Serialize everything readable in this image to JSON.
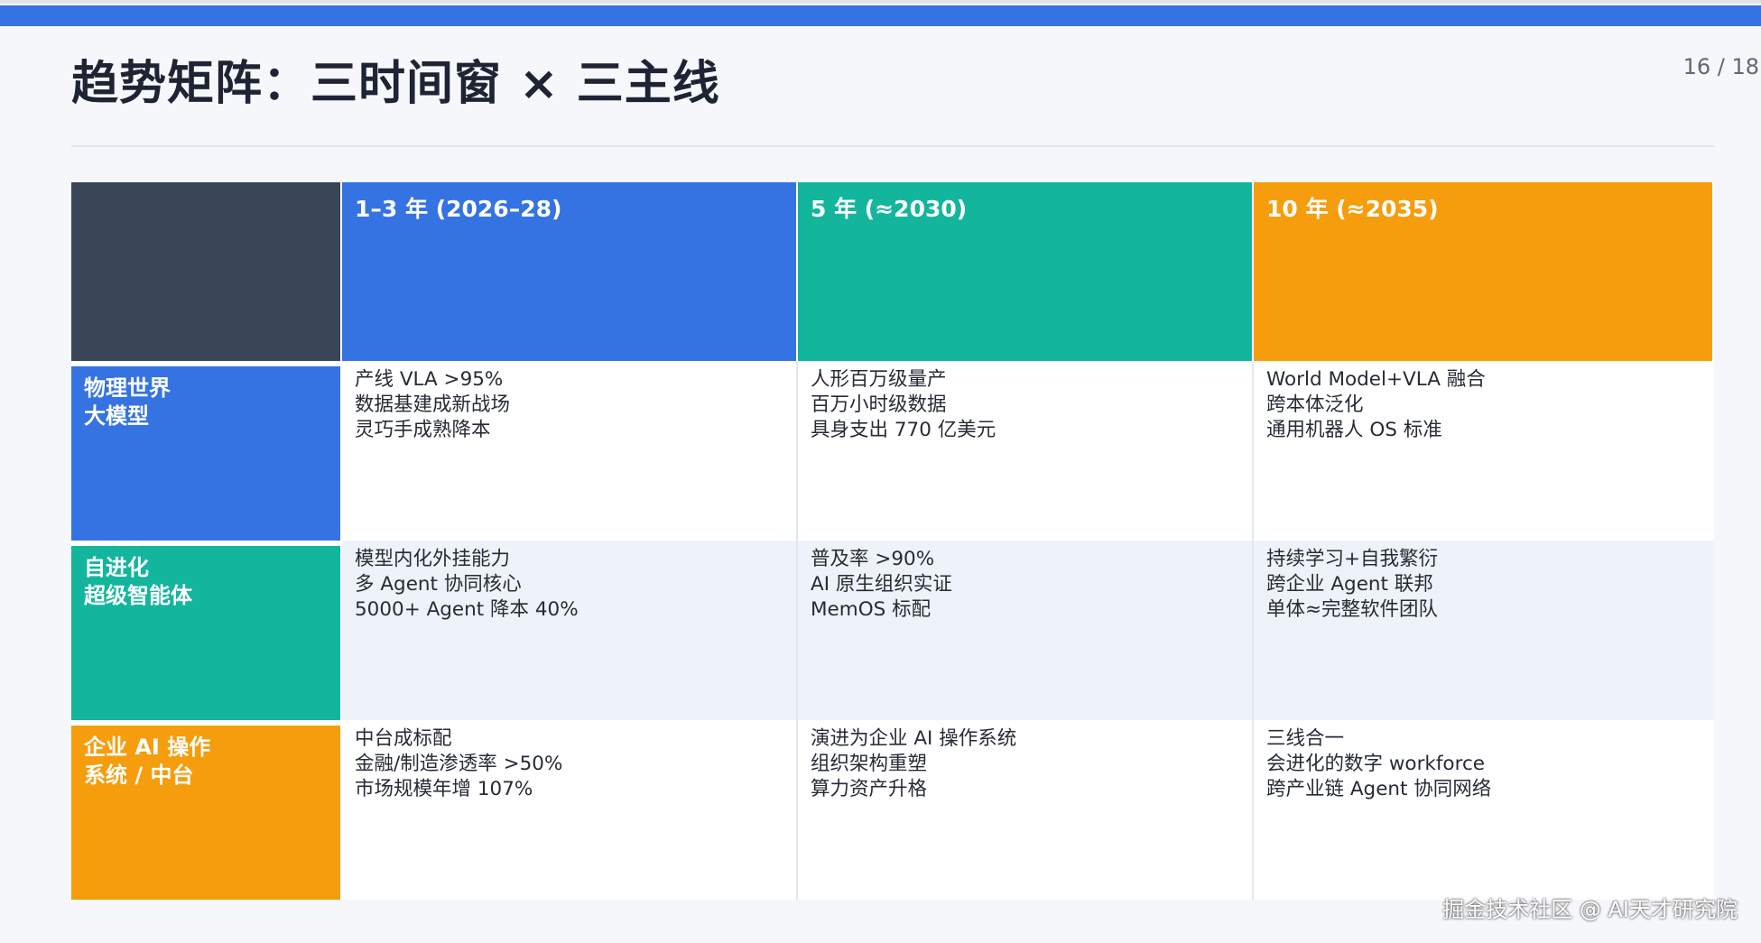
{
  "slide": {
    "title": "趋势矩阵：三时间窗 × 三主线",
    "page_number": "16 / 18"
  },
  "watermark": "掘金技术社区 @ AI天才研究院",
  "colors": {
    "accent_bar": "#3573e2",
    "corner": "#384657",
    "blue": "#3573e2",
    "teal": "#14b59d",
    "orange": "#f59d0d"
  },
  "matrix": {
    "columns": [
      {
        "label": "1–3 年 (2026–28)",
        "color": "#3573e2"
      },
      {
        "label": "5 年 (≈2030)",
        "color": "#14b59d"
      },
      {
        "label": "10 年 (≈2035)",
        "color": "#f59d0d"
      }
    ],
    "rows": [
      {
        "label": "物理世界\n大模型",
        "color": "#3573e2",
        "cells": [
          [
            "产线 VLA >95%",
            "数据基建成新战场",
            "灵巧手成熟降本"
          ],
          [
            "人形百万级量产",
            "百万小时级数据",
            "具身支出 770 亿美元"
          ],
          [
            "World Model+VLA 融合",
            "跨本体泛化",
            "通用机器人 OS 标准"
          ]
        ]
      },
      {
        "label": "自进化\n超级智能体",
        "color": "#14b59d",
        "cells": [
          [
            "模型内化外挂能力",
            "多 Agent 协同核心",
            "5000+ Agent 降本 40%"
          ],
          [
            "普及率 >90%",
            "AI 原生组织实证",
            "MemOS 标配"
          ],
          [
            "持续学习+自我繁衍",
            "跨企业 Agent 联邦",
            "单体≈完整软件团队"
          ]
        ]
      },
      {
        "label": "企业 AI 操作\n系统 / 中台",
        "color": "#f59d0d",
        "cells": [
          [
            "中台成标配",
            "金融/制造渗透率 >50%",
            "市场规模年增 107%"
          ],
          [
            "演进为企业 AI 操作系统",
            "组织架构重塑",
            "算力资产升格"
          ],
          [
            "三线合一",
            "会进化的数字 workforce",
            "跨产业链 Agent 协同网络"
          ]
        ]
      }
    ]
  }
}
